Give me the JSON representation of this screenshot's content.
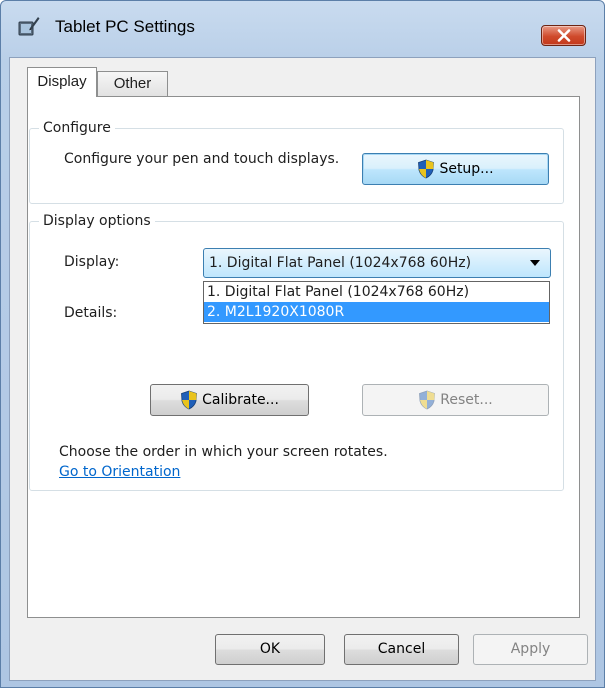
{
  "window": {
    "title": "Tablet PC Settings"
  },
  "tabs": [
    {
      "label": "Display",
      "active": true
    },
    {
      "label": "Other",
      "active": false
    }
  ],
  "configure": {
    "group_label": "Configure",
    "description": "Configure your pen and touch displays.",
    "setup_button": "Setup..."
  },
  "display_options": {
    "group_label": "Display options",
    "display_label": "Display:",
    "selected_display": "1. Digital Flat Panel (1024x768 60Hz)",
    "options": [
      {
        "label": "1. Digital Flat Panel (1024x768 60Hz)",
        "highlighted": false
      },
      {
        "label": "2. M2L1920X1080R",
        "highlighted": true
      }
    ],
    "details_label": "Details:",
    "calibrate_button": "Calibrate...",
    "reset_button": "Reset...",
    "reset_enabled": false
  },
  "orientation": {
    "text": "Choose the order in which your screen rotates.",
    "link": "Go to Orientation"
  },
  "footer": {
    "ok": "OK",
    "cancel": "Cancel",
    "apply": "Apply",
    "apply_enabled": false
  },
  "colors": {
    "accent": "#3399ff",
    "link": "#0066cc",
    "close": "#c3381b"
  },
  "icons": {
    "app": "tablet-pen-icon",
    "shield": "uac-shield-icon",
    "close": "close-icon"
  }
}
